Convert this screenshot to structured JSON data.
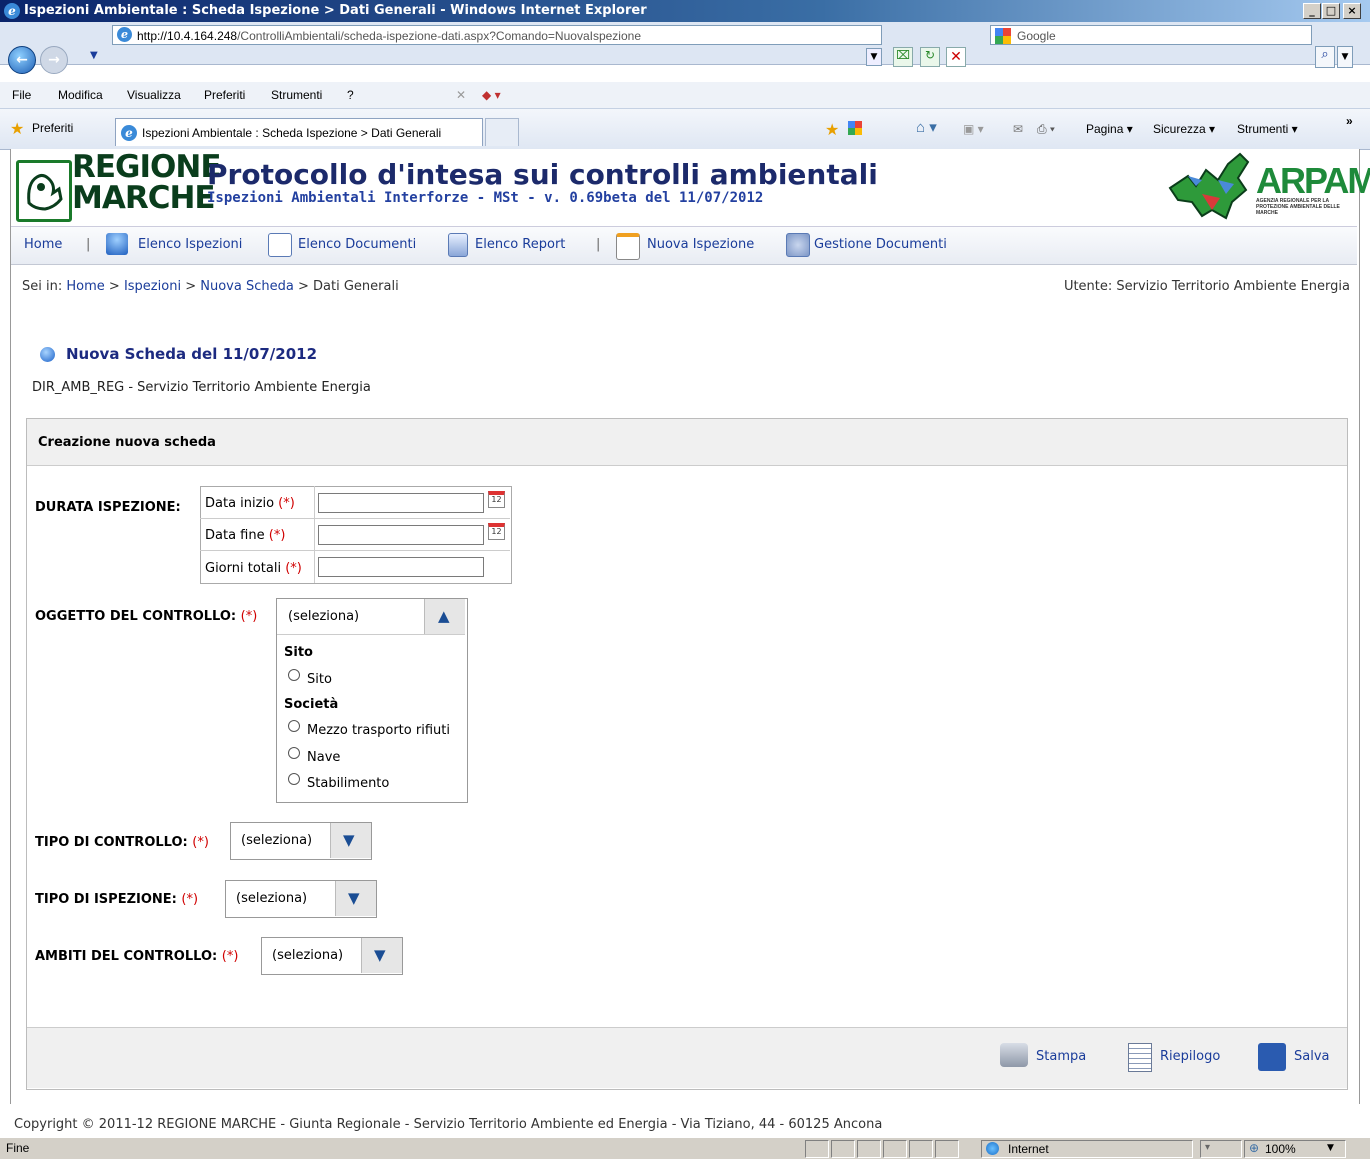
{
  "browser": {
    "window_title": "Ispezioni Ambientale : Scheda Ispezione > Dati Generali - Windows Internet Explorer",
    "url_host": "http://10.4.164.248",
    "url_path": "/ControlliAmbientali/scheda-ispezione-dati.aspx?Comando=NuovaIspezione",
    "search_engine": "Google",
    "menu": [
      "File",
      "Modifica",
      "Visualizza",
      "Preferiti",
      "Strumenti",
      "?"
    ],
    "favorites_label": "Preferiti",
    "tab_title": "Ispezioni Ambientale : Scheda Ispezione > Dati Generali",
    "commands": {
      "pagina": "Pagina ▾",
      "sicurezza": "Sicurezza ▾",
      "strumenti": "Strumenti ▾"
    },
    "status_left": "Fine",
    "zone": "Internet",
    "zoom": "100%"
  },
  "header": {
    "brand_line1": "REGIONE",
    "brand_line2": "MARCHE",
    "title": "Protocollo d'intesa sui controlli ambientali",
    "subtitle": "Ispezioni Ambientali Interforze - MSt - v. 0.69beta del 11/07/2012",
    "arpam": "ARPAM",
    "arpam_sub": "AGENZIA REGIONALE PER LA PROTEZIONE AMBIENTALE DELLE MARCHE"
  },
  "nav": {
    "home": "Home",
    "elenco_ispezioni": "Elenco Ispezioni",
    "elenco_documenti": "Elenco Documenti",
    "elenco_report": "Elenco Report",
    "nuova_ispezione": "Nuova Ispezione",
    "gestione_documenti": "Gestione Documenti"
  },
  "breadcrumb": {
    "prefix": "Sei in:",
    "home": "Home",
    "ispezioni": "Ispezioni",
    "nuova_scheda": "Nuova Scheda",
    "current": "Dati Generali",
    "sep": ">"
  },
  "user": "Utente: Servizio Territorio Ambiente Energia",
  "page": {
    "title": "Nuova Scheda del 11/07/2012",
    "dir": "DIR_AMB_REG - Servizio Territorio Ambiente Energia",
    "panel_title": "Creazione nuova scheda"
  },
  "form": {
    "required_mark": "(*)",
    "durata_label": "DURATA ISPEZIONE:",
    "data_inizio": "Data inizio",
    "data_fine": "Data fine",
    "giorni_totali": "Giorni totali",
    "calendar_day": "12",
    "oggetto_label": "OGGETTO DEL CONTROLLO:",
    "oggetto_value": "(seleziona)",
    "oggetto_groups": [
      {
        "name": "Sito",
        "options": [
          "Sito"
        ]
      },
      {
        "name": "Società",
        "options": [
          "Mezzo trasporto rifiuti",
          "Nave",
          "Stabilimento"
        ]
      }
    ],
    "tipo_controllo_label": "TIPO DI CONTROLLO:",
    "tipo_controllo_value": "(seleziona)",
    "tipo_ispezione_label": "TIPO DI ISPEZIONE:",
    "tipo_ispezione_value": "(seleziona)",
    "ambiti_label": "AMBITI DEL CONTROLLO:",
    "ambiti_value": "(seleziona)"
  },
  "actions": {
    "stampa": "Stampa",
    "riepilogo": "Riepilogo",
    "salva": "Salva"
  },
  "footer": "Copyright © 2011-12 REGIONE MARCHE - Giunta Regionale - Servizio Territorio Ambiente ed Energia - Via Tiziano, 44 - 60125 Ancona"
}
